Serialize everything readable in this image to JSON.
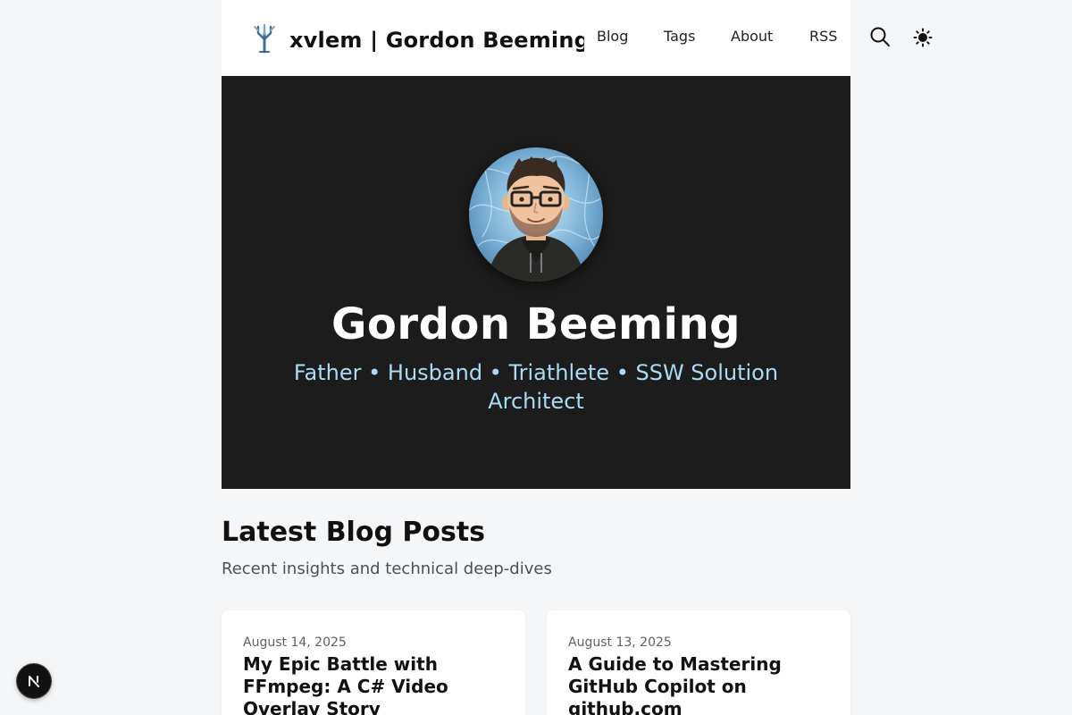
{
  "header": {
    "site_title": "xvlem | Gordon Beeming",
    "logo_icon": "tree-logo-icon",
    "nav": [
      {
        "label": "Blog"
      },
      {
        "label": "Tags"
      },
      {
        "label": "About"
      },
      {
        "label": "RSS"
      }
    ],
    "search_icon": "search-icon",
    "theme_icon": "sun-icon"
  },
  "hero": {
    "name": "Gordon Beeming",
    "tagline": "Father • Husband • Triathlete • SSW Solution Architect"
  },
  "latest": {
    "title": "Latest Blog Posts",
    "subtitle": "Recent insights and technical deep-dives",
    "posts": [
      {
        "date": "August 14, 2025",
        "title": "My Epic Battle with FFmpeg: A C# Video Overlay Story"
      },
      {
        "date": "August 13, 2025",
        "title": "A Guide to Mastering GitHub Copilot on github.com"
      }
    ]
  },
  "dev_badge": {
    "letter": "N",
    "icon": "nextjs-badge-icon"
  },
  "colors": {
    "page_bg": "#f5f6f8",
    "hero_bg": "#1c1c1d",
    "tagline": "#a9dcf3",
    "card_bg": "#ffffff"
  }
}
